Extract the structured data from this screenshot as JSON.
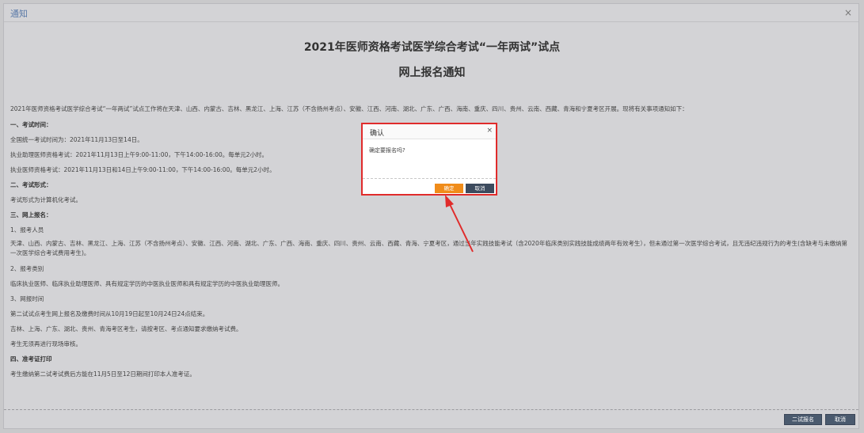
{
  "window": {
    "title": "通知",
    "close_glyph": "×"
  },
  "document": {
    "title": "2021年医师资格考试医学综合考试“一年两试”试点",
    "subtitle": "网上报名通知",
    "lines": [
      "2021年医师资格考试医学综合考试“一年两试”试点工作将在天津、山西、内蒙古、吉林、黑龙江、上海、江苏（不含扬州考点）、安徽、江西、河南、湖北、广东、广西、海南、重庆、四川、贵州、云南、西藏、青海和宁夏考区开展。现将有关事项通知如下：",
      "一、考试时间：",
      "全国统一考试时间为：2021年11月13日至14日。",
      "执业助理医师资格考试：2021年11月13日上午9:00-11:00，下午14:00-16:00。每单元2小时。",
      "执业医师资格考试：2021年11月13日和14日上午9:00-11:00，下午14:00-16:00。每单元2小时。",
      "二、考试形式：",
      "考试形式为计算机化考试。",
      "三、网上报名：",
      "1、报考人员",
      "天津、山西、内蒙古、吉林、黑龙江、上海、江苏（不含扬州考点）、安徽、江西、河南、湖北、广东、广西、海南、重庆、四川、贵州、云南、西藏、青海、宁夏考区，通过当年实践技能考试（含2020年临床类别实践技能成绩两年有效考生），但未通过第一次医学综合考试，且无违纪违规行为的考生(含缺考与未缴纳第一次医学综合考试费用考生)。",
      "2、报考类别",
      "临床执业医师、临床执业助理医师、具有规定学历的中医执业医师和具有规定学历的中医执业助理医师。",
      "3、网报时间",
      "第二试试点考生网上报名及缴费时间从10月19日起至10月24日24点结束。",
      "吉林、上海、广东、湖北、贵州、青海考区考生，请按考区、考点通知要求缴纳考试费。",
      "考生无须再进行现场审核。",
      "四、准考证打印",
      "考生缴纳第二试考试费后方能在11月5日至12日期间打印本人准考证。"
    ]
  },
  "footer": {
    "second_signup_label": "二试报名",
    "cancel_label": "取消"
  },
  "dialog": {
    "title": "确认",
    "close_glyph": "×",
    "message": "确定要报名吗?",
    "ok_label": "确定",
    "cancel_label": "取消"
  },
  "colors": {
    "highlight_red": "#e02b2b",
    "ok_orange": "#f08c1a",
    "button_dark": "#3d4b5e",
    "title_blue": "#5a7aa8"
  }
}
